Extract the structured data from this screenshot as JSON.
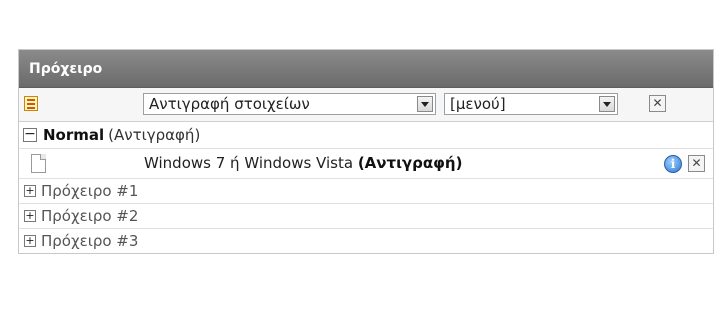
{
  "panel": {
    "title": "Πρόχειρο",
    "toolbar": {
      "list_icon": "list-icon",
      "select_items_value": "Αντιγραφή στοιχείων",
      "select_menu_value": "[μενού]",
      "close_symbol": "✕"
    },
    "normal_group": {
      "expander": "−",
      "name": "Normal",
      "subtitle": "(Αντιγραφή)",
      "item": {
        "icon": "document-icon",
        "text": "Windows 7 ή Windows Vista",
        "action": "(Αντιγραφή)",
        "info_symbol": "i",
        "remove_symbol": "✕"
      }
    },
    "clipboards": [
      {
        "expander": "+",
        "label": "Πρόχειρο #1"
      },
      {
        "expander": "+",
        "label": "Πρόχειρο #2"
      },
      {
        "expander": "+",
        "label": "Πρόχειρο #3"
      }
    ]
  }
}
